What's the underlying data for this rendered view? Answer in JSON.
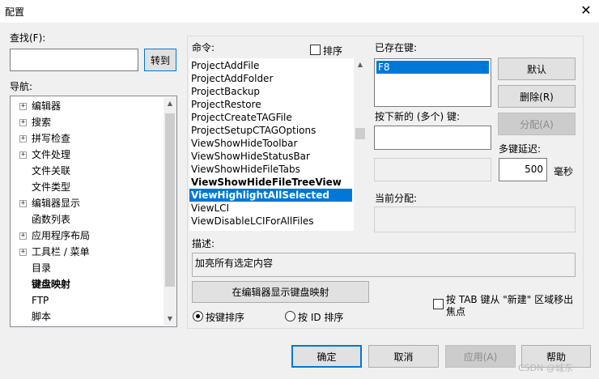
{
  "window": {
    "title": "配置",
    "close_glyph": "✕"
  },
  "find": {
    "label": "查找(F):",
    "value": "",
    "goto_button": "转到"
  },
  "nav": {
    "label": "导航:",
    "items": [
      {
        "label": "编辑器",
        "expandable": true,
        "bold": false
      },
      {
        "label": "搜索",
        "expandable": true,
        "bold": false
      },
      {
        "label": "拼写检查",
        "expandable": true,
        "bold": false
      },
      {
        "label": "文件处理",
        "expandable": true,
        "bold": false
      },
      {
        "label": "文件关联",
        "expandable": false,
        "bold": false
      },
      {
        "label": "文件类型",
        "expandable": false,
        "bold": false
      },
      {
        "label": "编辑器显示",
        "expandable": true,
        "bold": false
      },
      {
        "label": "函数列表",
        "expandable": false,
        "bold": false
      },
      {
        "label": "应用程序布局",
        "expandable": true,
        "bold": false
      },
      {
        "label": "工具栏 / 菜单",
        "expandable": true,
        "bold": false
      },
      {
        "label": "目录",
        "expandable": false,
        "bold": false
      },
      {
        "label": "键盘映射",
        "expandable": false,
        "bold": true
      },
      {
        "label": "FTP",
        "expandable": false,
        "bold": false
      },
      {
        "label": "脚本",
        "expandable": false,
        "bold": false
      }
    ]
  },
  "commands": {
    "label": "命令:",
    "sort_label": "排序",
    "items": [
      {
        "label": "ProjectAddFile",
        "bold": false,
        "selected": false
      },
      {
        "label": "ProjectAddFolder",
        "bold": false,
        "selected": false
      },
      {
        "label": "ProjectBackup",
        "bold": false,
        "selected": false
      },
      {
        "label": "ProjectRestore",
        "bold": false,
        "selected": false
      },
      {
        "label": "ProjectCreateTAGFile",
        "bold": false,
        "selected": false
      },
      {
        "label": "ProjectSetupCTAGOptions",
        "bold": false,
        "selected": false
      },
      {
        "label": "ViewShowHideToolbar",
        "bold": false,
        "selected": false
      },
      {
        "label": "ViewShowHideStatusBar",
        "bold": false,
        "selected": false
      },
      {
        "label": "ViewShowHideFileTabs",
        "bold": false,
        "selected": false
      },
      {
        "label": "ViewShowHideFileTreeView",
        "bold": true,
        "selected": false
      },
      {
        "label": "ViewHighlightAllSelected",
        "bold": true,
        "selected": true
      },
      {
        "label": "ViewLCI",
        "bold": false,
        "selected": false
      },
      {
        "label": "ViewDisableLCIForAllFiles",
        "bold": false,
        "selected": false
      }
    ]
  },
  "description": {
    "label": "描述:",
    "value": "加亮所有选定内容"
  },
  "show_map_button": "在编辑器显示键盘映射",
  "sort_mode": {
    "by_key": "按键排序",
    "by_id": "按 ID 排序",
    "selected": "by_key"
  },
  "existing_keys": {
    "label": "已存在键:",
    "items": [
      "F8"
    ]
  },
  "buttons": {
    "default": "默认",
    "delete": "删除(R)",
    "assign": "分配(A)"
  },
  "new_key": {
    "label": "按下新的 (多个) 键:",
    "value": ""
  },
  "multi_key_delay": {
    "label": "多键延迟:",
    "value": "500",
    "unit": "毫秒"
  },
  "current_assign": {
    "label": "当前分配:",
    "value": ""
  },
  "tab_option": {
    "label_line1": "按 TAB 键从 \"新建\" 区域移出",
    "label_line2": "焦点",
    "checked": false
  },
  "footer": {
    "ok": "确定",
    "cancel": "取消",
    "apply": "应用(A)",
    "help": "帮助"
  },
  "watermark": "CSDN @城东"
}
